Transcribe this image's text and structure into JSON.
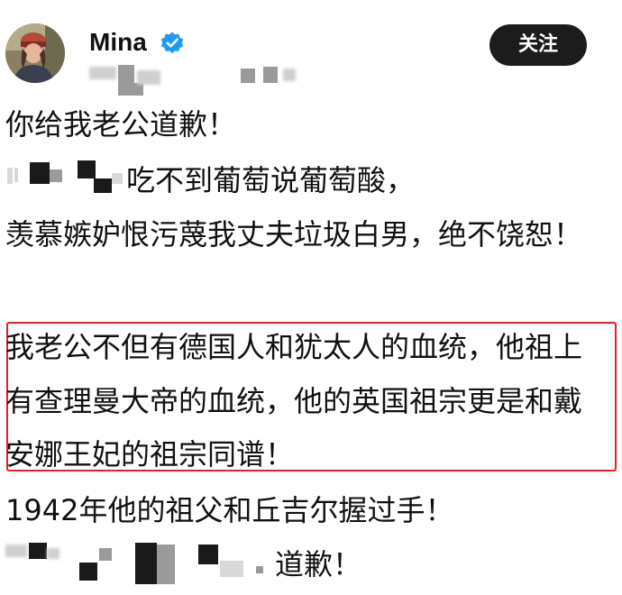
{
  "user": {
    "name": "Mina",
    "verified_icon": "verified-badge-icon",
    "verified_color": "#1d9bf0",
    "follow_label": "关注"
  },
  "post": {
    "line1": "你给我老公道歉！",
    "line2": "吃不到葡萄说葡萄酸，",
    "line3": "羡慕嫉妒恨污蔑我丈夫垃圾白男，绝不饶恕！",
    "line4": "我老公不但有德国人和犹太人的血统，他祖上",
    "line5": "有查理曼大帝的血统，他的英国祖宗更是和戴",
    "line6": "安娜王妃的祖宗同谱！",
    "line7": "1942年他的祖父和丘吉尔握过手！",
    "line8": "道歉！"
  },
  "colors": {
    "highlight_border": "#e0202a",
    "follow_button_bg": "#1c1c1c"
  }
}
